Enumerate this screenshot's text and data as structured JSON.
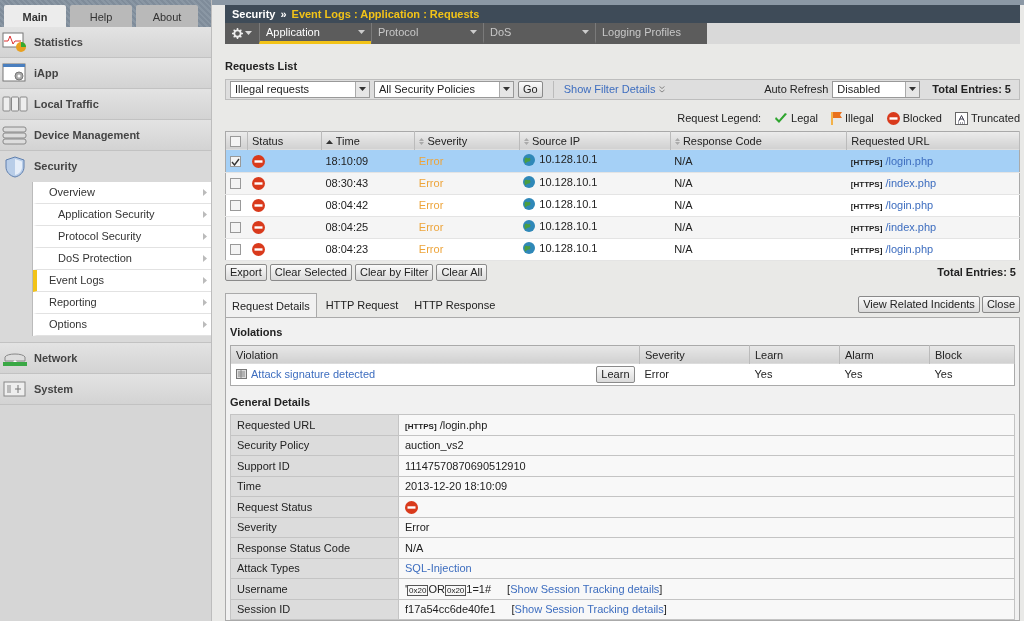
{
  "sidebar": {
    "tabs": [
      {
        "label": "Main",
        "selected": true
      },
      {
        "label": "Help",
        "selected": false
      },
      {
        "label": "About",
        "selected": false
      }
    ],
    "items": [
      {
        "label": "Statistics",
        "expanded": false
      },
      {
        "label": "iApp",
        "expanded": false
      },
      {
        "label": "Local Traffic",
        "expanded": false
      },
      {
        "label": "Device Management",
        "expanded": false
      },
      {
        "label": "Security",
        "expanded": true,
        "children": [
          {
            "label": "Overview",
            "selected": false,
            "children": [
              {
                "label": "Application Security",
                "selected": false
              },
              {
                "label": "Protocol Security",
                "selected": false
              },
              {
                "label": "DoS Protection",
                "selected": false
              }
            ]
          },
          {
            "label": "Event Logs",
            "selected": true
          },
          {
            "label": "Reporting",
            "selected": false
          },
          {
            "label": "Options",
            "selected": false
          }
        ]
      },
      {
        "label": "Network",
        "expanded": false
      },
      {
        "label": "System",
        "expanded": false
      }
    ]
  },
  "breadcrumb": {
    "section": "Security",
    "separator": "»",
    "path": "Event Logs : Application : Requests"
  },
  "nav_tabs": [
    {
      "label": "Application",
      "selected": true,
      "has_menu": true
    },
    {
      "label": "Protocol",
      "selected": false,
      "has_menu": true
    },
    {
      "label": "DoS",
      "selected": false,
      "has_menu": true
    },
    {
      "label": "Logging Profiles",
      "selected": false,
      "has_menu": false
    }
  ],
  "requests": {
    "title": "Requests List",
    "filters": [
      {
        "value": "Illegal requests"
      },
      {
        "value": "All Security Policies"
      }
    ],
    "go": "Go",
    "filter_link": "Show Filter Details",
    "auto_refresh_label": "Auto Refresh",
    "auto_refresh": "Disabled",
    "total_top": "Total Entries: 5",
    "legend_label": "Request Legend:",
    "legend": [
      {
        "kind": "legal",
        "label": "Legal"
      },
      {
        "kind": "illegal",
        "label": "Illegal"
      },
      {
        "kind": "blocked",
        "label": "Blocked"
      },
      {
        "kind": "truncated",
        "label": "Truncated"
      }
    ],
    "all_checked": false,
    "columns": [
      {
        "label": "Status",
        "kind": "plain"
      },
      {
        "label": "Time",
        "kind": "sorted"
      },
      {
        "label": "Severity",
        "kind": "sortable"
      },
      {
        "label": "Source IP",
        "kind": "sortable"
      },
      {
        "label": "Response Code",
        "kind": "sortable"
      },
      {
        "label": "Requested URL",
        "kind": "plain"
      }
    ],
    "rows": [
      {
        "checked": true,
        "selected": true,
        "blocked": true,
        "time": "18:10:09",
        "severity": "Error",
        "ip": "10.128.10.1",
        "response_code": "N/A",
        "protocol": "[HTTPS]",
        "url": "/login.php"
      },
      {
        "checked": false,
        "selected": false,
        "blocked": true,
        "time": "08:30:43",
        "severity": "Error",
        "ip": "10.128.10.1",
        "response_code": "N/A",
        "protocol": "[HTTPS]",
        "url": "/index.php"
      },
      {
        "checked": false,
        "selected": false,
        "blocked": true,
        "time": "08:04:42",
        "severity": "Error",
        "ip": "10.128.10.1",
        "response_code": "N/A",
        "protocol": "[HTTPS]",
        "url": "/login.php"
      },
      {
        "checked": false,
        "selected": false,
        "blocked": true,
        "time": "08:04:25",
        "severity": "Error",
        "ip": "10.128.10.1",
        "response_code": "N/A",
        "protocol": "[HTTPS]",
        "url": "/index.php"
      },
      {
        "checked": false,
        "selected": false,
        "blocked": true,
        "time": "08:04:23",
        "severity": "Error",
        "ip": "10.128.10.1",
        "response_code": "N/A",
        "protocol": "[HTTPS]",
        "url": "/login.php"
      }
    ],
    "actions": [
      "Export",
      "Clear Selected",
      "Clear by Filter",
      "Clear All"
    ],
    "total_bottom": "Total Entries: 5"
  },
  "details": {
    "tabs": [
      {
        "label": "Request Details",
        "selected": true
      },
      {
        "label": "HTTP Request",
        "selected": false
      },
      {
        "label": "HTTP Response",
        "selected": false
      }
    ],
    "buttons": [
      "View Related Incidents",
      "Close"
    ],
    "violations_title": "Violations",
    "violation_columns": [
      "Violation",
      "Severity",
      "Learn",
      "Alarm",
      "Block"
    ],
    "violations": [
      {
        "name": "Attack signature detected",
        "learn_button": "Learn",
        "severity": "Error",
        "learn": "Yes",
        "alarm": "Yes",
        "block": "Yes"
      }
    ],
    "general_title": "General Details",
    "general": [
      {
        "label": "Requested URL",
        "kind": "url",
        "protocol": "[HTTPS]",
        "value": "/login.php"
      },
      {
        "label": "Security Policy",
        "kind": "text",
        "value": "auction_vs2"
      },
      {
        "label": "Support ID",
        "kind": "text",
        "value": "11147570870690512910"
      },
      {
        "label": "Time",
        "kind": "text",
        "value": "2013-12-20 18:10:09"
      },
      {
        "label": "Request Status",
        "kind": "status",
        "blocked": true
      },
      {
        "label": "Severity",
        "kind": "text",
        "value": "Error"
      },
      {
        "label": "Response Status Code",
        "kind": "text",
        "value": "N/A"
      },
      {
        "label": "Attack Types",
        "kind": "link",
        "value": "SQL-Injection"
      },
      {
        "label": "Username",
        "kind": "parts",
        "parts": [
          {
            "text": "'",
            "boxed": false
          },
          {
            "text": "0x20",
            "boxed": true
          },
          {
            "text": "OR",
            "boxed": false
          },
          {
            "text": "0x20",
            "boxed": true
          },
          {
            "text": "1=1#",
            "boxed": false
          }
        ],
        "link_prefix": "[",
        "link": "Show Session Tracking details",
        "link_suffix": "]"
      },
      {
        "label": "Session ID",
        "kind": "text",
        "value": "f17a54cc6de40fe1",
        "link_prefix": "[",
        "link": "Show Session Tracking details",
        "link_suffix": "]"
      }
    ]
  }
}
